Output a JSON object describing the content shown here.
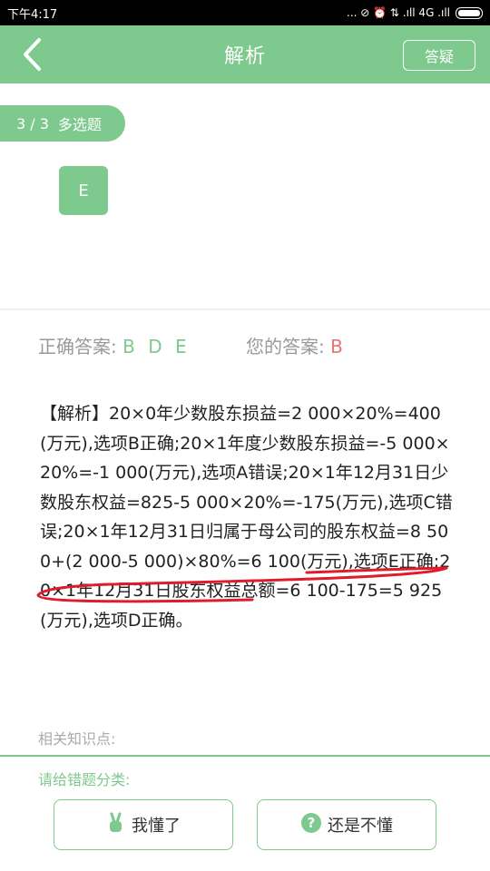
{
  "status_bar": {
    "time": "下午4:17",
    "indicators": "... ⊘ ⏰ ⇅ .ıll 4G .ıll",
    "battery_icon": "battery-full-icon"
  },
  "app_bar": {
    "title": "解析",
    "back_icon": "back-chevron-icon",
    "query_button": "答疑"
  },
  "question": {
    "progress": "3 / 3",
    "type": "多选题",
    "selected_option": "E"
  },
  "answers": {
    "correct_label": "正确答案:",
    "correct_value": "B D E",
    "mine_label": "您的答案:",
    "mine_value": "B"
  },
  "analysis": {
    "part1": "【解析】20×0年少数股东损益=2 000×20%=400(万元),选项B正确;20×1年度少数股东损益=-5 000×20%=-1 000(万元),选项A错误;20×1年12月31日少数股东权益=825-5 000×20%=-175(万元),选项C错误;20×1年12月31日归属于母公司的股东权益",
    "part2": "=8 500+(2 000-5 000)×80%=6 100(万元)",
    "part3": ",选项E正确;20×1年12月31日股东权益总额=6 100-175=5 925(万元),选项D正确。"
  },
  "related_label": "相关知识点:",
  "classify": {
    "label": "请给错题分类:",
    "understood": "我懂了",
    "understood_icon": "victory-hand-icon",
    "not_understood": "还是不懂",
    "not_understood_icon": "question-circle-icon"
  },
  "colors": {
    "accent": "#7ec98e",
    "wrong": "#e57373",
    "annotation_red": "#e01c2c"
  }
}
